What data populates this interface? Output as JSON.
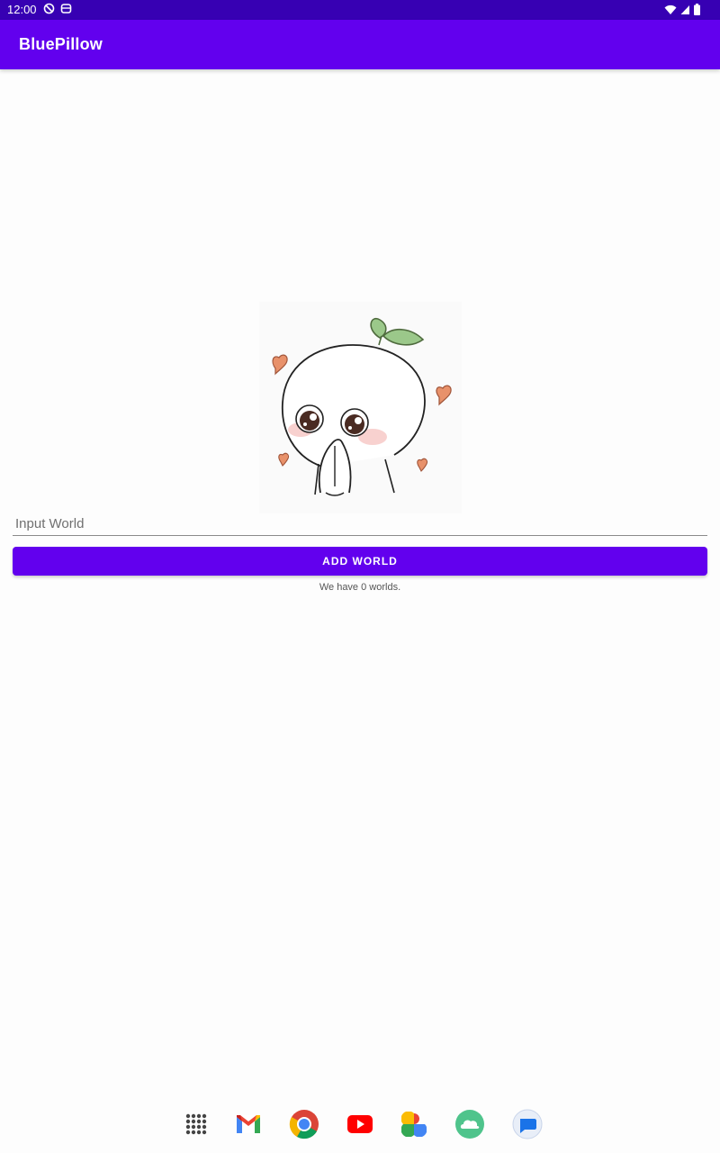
{
  "status_bar": {
    "time": "12:00",
    "left_icons": [
      "do-not-disturb-icon",
      "notification-icon"
    ],
    "right_icons": [
      "wifi-icon",
      "signal-icon",
      "battery-icon"
    ]
  },
  "app_bar": {
    "title": "BluePillow"
  },
  "main": {
    "illustration": "sprout-character-praying-illustration",
    "input": {
      "value": "",
      "placeholder": "Input World"
    },
    "add_button_label": "ADD WORLD",
    "count_text": "We have 0 worlds."
  },
  "dock": {
    "apps": [
      "app-drawer-icon",
      "gmail-icon",
      "chrome-icon",
      "youtube-icon",
      "photos-icon",
      "cloud-app-icon",
      "messages-icon"
    ]
  },
  "colors": {
    "primary": "#6200ee",
    "primary_dark": "#3700b3",
    "background": "#fdfdfd"
  }
}
